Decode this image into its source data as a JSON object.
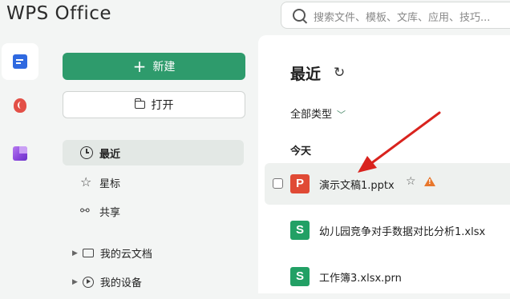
{
  "header": {
    "app_name": "WPS Office",
    "search_placeholder": "搜索文件、模板、文库、应用、技巧..."
  },
  "rail": {
    "items": [
      {
        "name": "documents",
        "icon": "document-icon",
        "active": true
      },
      {
        "name": "pdf",
        "icon": "pdf-icon",
        "active": false
      },
      {
        "name": "apps",
        "icon": "apps-icon",
        "active": false
      }
    ]
  },
  "sidebar": {
    "new_label": "新建",
    "open_label": "打开",
    "nav": [
      {
        "label": "最近",
        "icon": "clock-icon",
        "active": true
      },
      {
        "label": "星标",
        "icon": "star-icon",
        "active": false
      },
      {
        "label": "共享",
        "icon": "share-icon",
        "active": false
      }
    ],
    "tree": [
      {
        "label": "我的云文档",
        "icon": "folder-icon"
      },
      {
        "label": "我的设备",
        "icon": "device-icon"
      }
    ]
  },
  "main": {
    "title": "最近",
    "filter_label": "全部类型",
    "group_label": "今天",
    "files": [
      {
        "name": "演示文稿1.pptx",
        "type_letter": "P",
        "type": "presentation",
        "starred_icon": "star-outline-icon",
        "warning": true,
        "selected": true
      },
      {
        "name": "幼儿园竞争对手数据对比分析1.xlsx",
        "type_letter": "S",
        "type": "spreadsheet",
        "selected": false
      },
      {
        "name": "工作簿3.xlsx.prn",
        "type_letter": "S",
        "type": "spreadsheet",
        "selected": false
      }
    ]
  },
  "colors": {
    "accent_green": "#2e9b6c",
    "ppt_red": "#e04a35",
    "sheet_green": "#22a065",
    "warning_orange": "#e8772c",
    "annotation_red": "#d9231e"
  }
}
